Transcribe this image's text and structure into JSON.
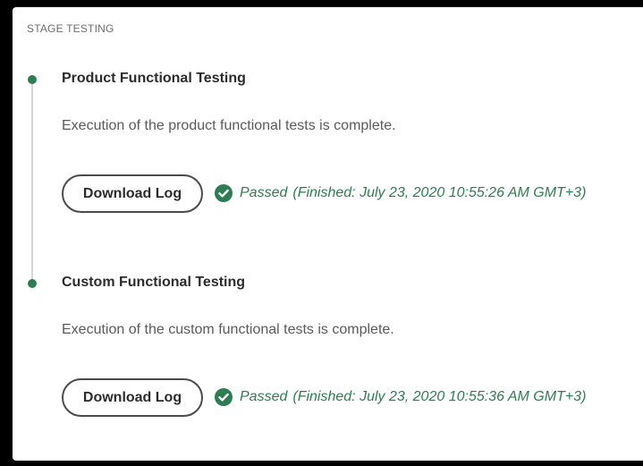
{
  "section": {
    "title": "STAGE TESTING"
  },
  "colors": {
    "success": "#2d7d52",
    "timeline": "#d6d6d6",
    "text_primary": "#2c2c2c",
    "text_secondary": "#5a5a5a"
  },
  "steps": [
    {
      "title": "Product Functional Testing",
      "description": "Execution of the product functional tests is complete.",
      "button_label": "Download Log",
      "status_icon": "check-circle-icon",
      "status_label": "Passed",
      "status_detail": "(Finished: July 23, 2020 10:55:26 AM GMT+3)"
    },
    {
      "title": "Custom Functional Testing",
      "description": "Execution of the custom functional tests is complete.",
      "button_label": "Download Log",
      "status_icon": "check-circle-icon",
      "status_label": "Passed",
      "status_detail": "(Finished: July 23, 2020 10:55:36 AM GMT+3)"
    }
  ]
}
